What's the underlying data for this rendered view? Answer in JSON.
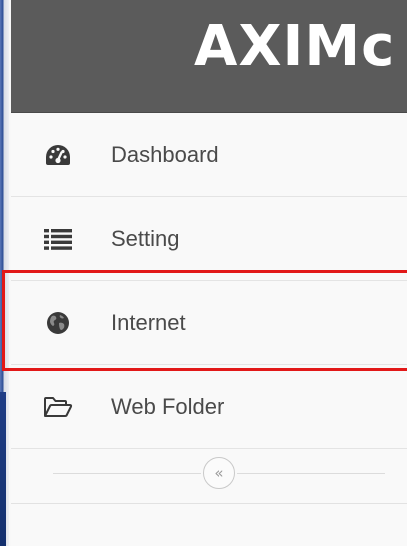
{
  "header": {
    "logo_text": "AXIMc"
  },
  "menu": {
    "items": [
      {
        "label": "Dashboard",
        "icon": "dashboard-icon"
      },
      {
        "label": "Setting",
        "icon": "list-icon"
      },
      {
        "label": "Internet",
        "icon": "globe-icon"
      },
      {
        "label": "Web Folder",
        "icon": "folder-open-icon"
      }
    ],
    "collapse_label": "«"
  },
  "colors": {
    "header_bg": "#5b5b5b",
    "highlight": "#e21818",
    "text": "#4a4a4a"
  }
}
